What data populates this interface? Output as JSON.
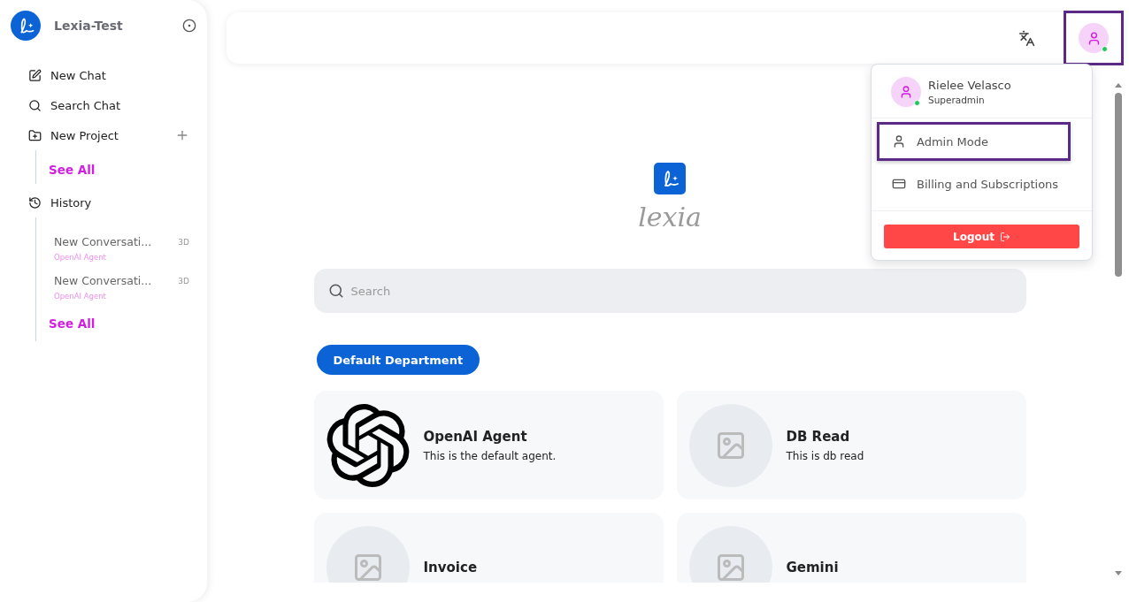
{
  "sidebar": {
    "workspace": "Lexia-Test",
    "nav": [
      {
        "kind": "new-chat",
        "label": "New Chat"
      },
      {
        "kind": "search",
        "label": "Search Chat"
      },
      {
        "kind": "project",
        "label": "New Project"
      }
    ],
    "projects_see_all": "See All",
    "history_label": "History",
    "history": [
      {
        "title": "New Conversati...",
        "agent": "OpenAI Agent",
        "age": "3D"
      },
      {
        "title": "New Conversati...",
        "agent": "OpenAI Agent",
        "age": "3D"
      }
    ],
    "history_see_all": "See All"
  },
  "header": {
    "avatar_highlighted": true,
    "online": true
  },
  "user_menu": {
    "name": "Rielee Velasco",
    "role": "Superadmin",
    "online": true,
    "items": [
      {
        "kind": "person",
        "label": "Admin Mode",
        "highlighted": true
      },
      {
        "kind": "card",
        "label": "Billing and Subscriptions",
        "highlighted": false
      }
    ],
    "logout": "Logout"
  },
  "main": {
    "logo_text": "lexia",
    "search": {
      "placeholder": "Search"
    },
    "department": "Default Department",
    "agents": [
      {
        "kind": "openai",
        "name": "OpenAI Agent",
        "description": "This is the default agent."
      },
      {
        "kind": "image",
        "name": "DB Read",
        "description": "This is db read"
      },
      {
        "kind": "image",
        "name": "Invoice"
      },
      {
        "kind": "image",
        "name": "Gemini"
      }
    ]
  }
}
